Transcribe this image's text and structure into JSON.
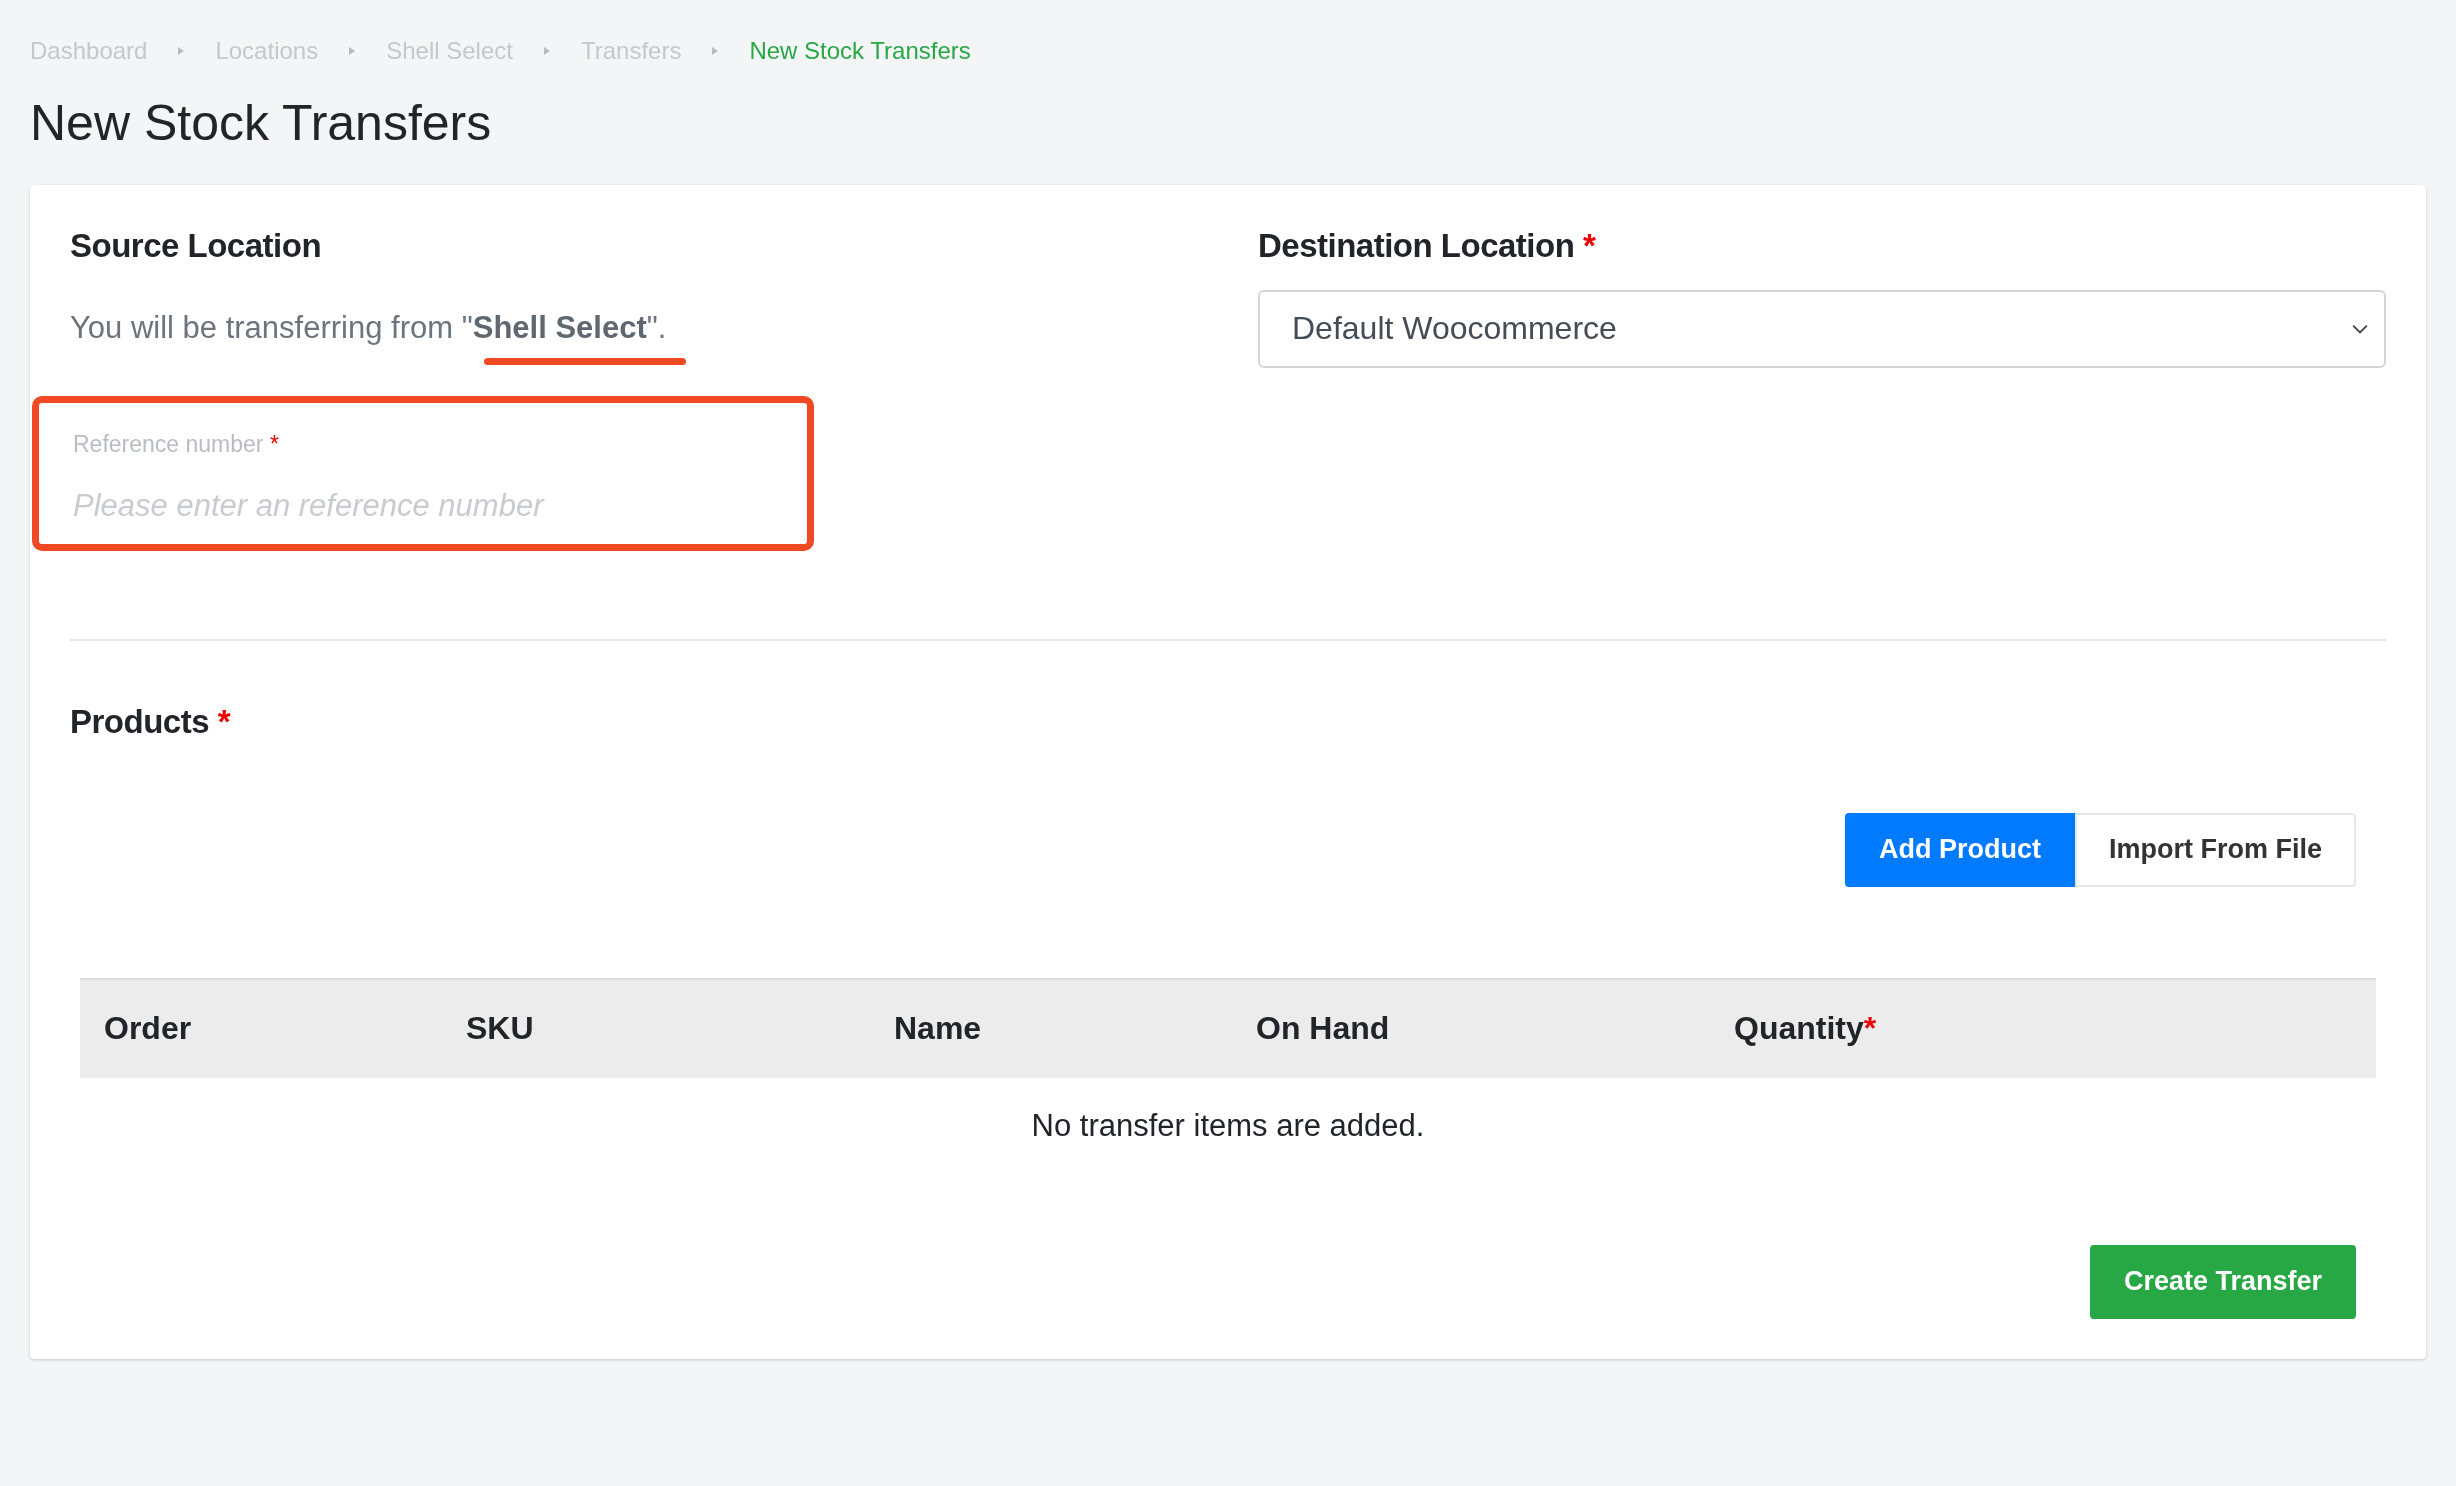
{
  "breadcrumb": [
    {
      "label": "Dashboard",
      "selected": false
    },
    {
      "label": "Locations",
      "selected": false
    },
    {
      "label": "Shell Select",
      "selected": false
    },
    {
      "label": "Transfers",
      "selected": false
    },
    {
      "label": "New Stock Transfers",
      "selected": true
    }
  ],
  "page_title": "New Stock Transfers",
  "source": {
    "heading": "Source Location",
    "text": "You will be transferring from \"**Shell Select**\".",
    "reference": {
      "label": "Reference number",
      "required_mark": "*",
      "placeholder": "Please enter an reference number"
    }
  },
  "destination": {
    "heading": "Destination Location",
    "required_mark": "*",
    "value": "Default Woocommerce"
  },
  "products": {
    "heading": "Products",
    "required_mark": "*",
    "buttons": [
      {
        "label": "Add Product",
        "kind": "primary"
      },
      {
        "label": "Import From File",
        "kind": "outline"
      }
    ],
    "table": {
      "columns": [
        {
          "label": "Order"
        },
        {
          "label": "SKU"
        },
        {
          "label": "Name"
        },
        {
          "label": "On Hand"
        },
        {
          "label": "Quantity",
          "required_mark": "*"
        }
      ],
      "empty_text": "No transfer items are added."
    }
  },
  "submit": "Create Transfer"
}
